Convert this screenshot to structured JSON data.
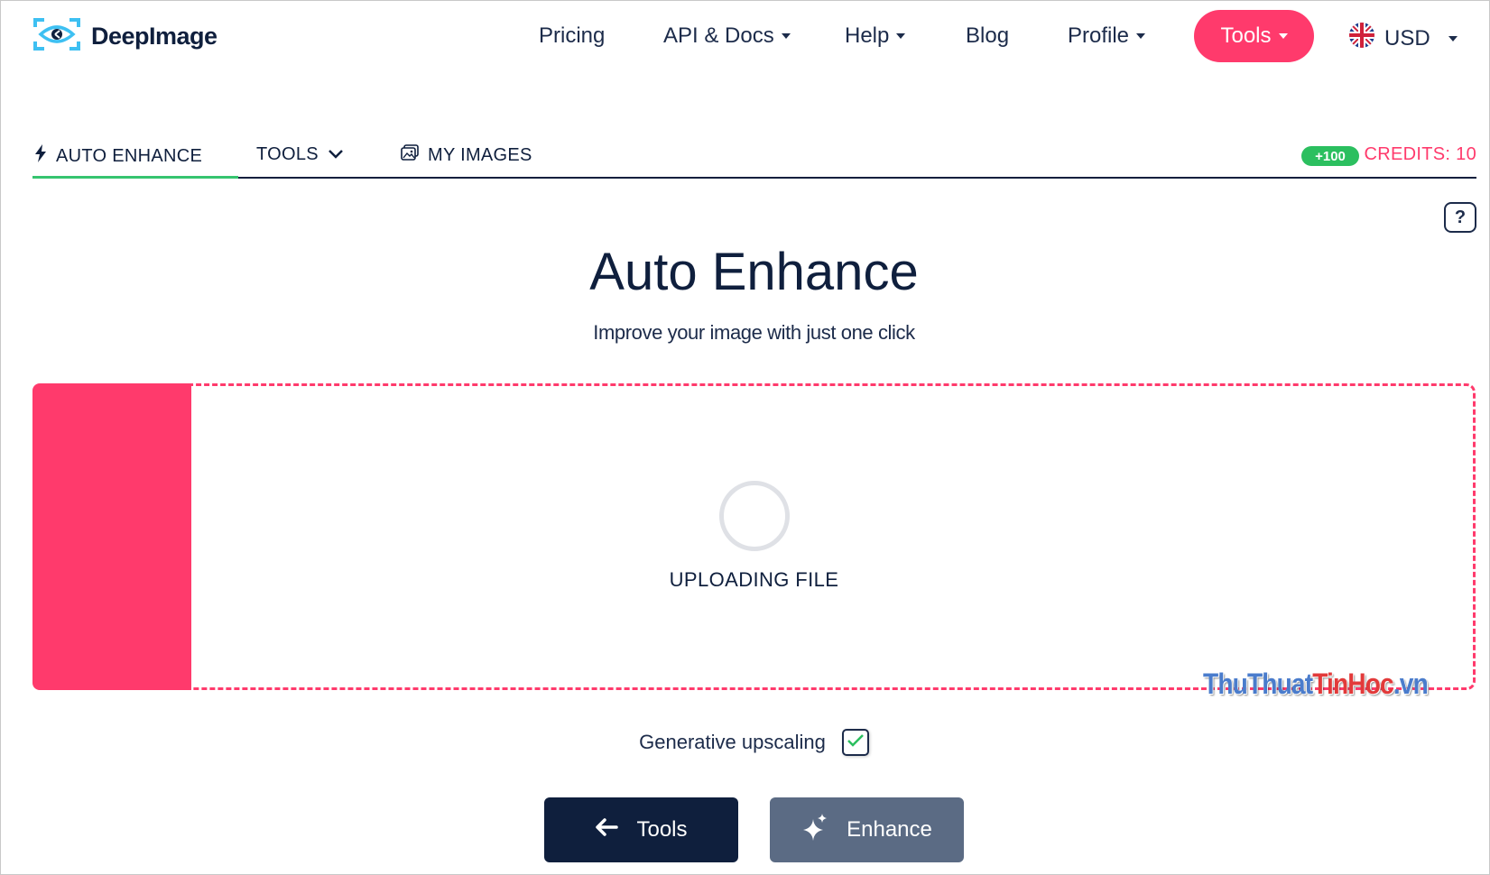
{
  "brand": {
    "name": "DeepImage"
  },
  "nav": {
    "pricing": "Pricing",
    "api_docs": "API & Docs",
    "help": "Help",
    "blog": "Blog",
    "profile": "Profile",
    "tools": "Tools",
    "currency": "USD"
  },
  "tabs": {
    "auto_enhance": "AUTO ENHANCE",
    "tools": "TOOLS",
    "my_images": "MY IMAGES",
    "bonus_badge": "+100",
    "credits": "CREDITS: 10"
  },
  "help_button": "?",
  "main": {
    "title": "Auto Enhance",
    "subtitle": "Improve your image with just one click",
    "upload_status": "UPLOADING FILE",
    "generative_upscaling_label": "Generative upscaling",
    "generative_upscaling_checked": true
  },
  "buttons": {
    "back_tools": "Tools",
    "enhance": "Enhance"
  },
  "watermark": {
    "part1": "ThuThuat",
    "part2": "TinHoc",
    "part3": ".vn"
  },
  "colors": {
    "accent_pink": "#ff3a6c",
    "navy": "#0f1f3d",
    "green": "#2bbf5f",
    "enhance_gray": "#5b6b84"
  },
  "icons": [
    "eye-logo-icon",
    "uk-flag-icon",
    "bolt-icon",
    "chevron-down-icon",
    "images-icon",
    "arrow-left-icon",
    "sparkle-icon",
    "check-icon"
  ]
}
